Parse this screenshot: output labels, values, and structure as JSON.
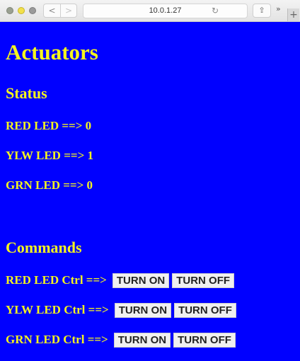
{
  "browser": {
    "url": "10.0.1.27",
    "back_glyph": "<",
    "forward_glyph": ">",
    "reload_glyph": "↻",
    "share_glyph": "⇪",
    "more_glyph": "»",
    "new_tab_glyph": "+"
  },
  "page": {
    "title": "Actuators",
    "status": {
      "heading": "Status",
      "rows": [
        {
          "label": "RED LED ==> 0"
        },
        {
          "label": "YLW LED ==> 1"
        },
        {
          "label": "GRN LED ==> 0"
        }
      ]
    },
    "commands": {
      "heading": "Commands",
      "rows": [
        {
          "label": "RED LED Ctrl ==>",
          "on": "TURN ON",
          "off": "TURN OFF"
        },
        {
          "label": "YLW LED Ctrl ==>",
          "on": "TURN ON",
          "off": "TURN OFF"
        },
        {
          "label": "GRN LED Ctrl ==>",
          "on": "TURN ON",
          "off": "TURN OFF"
        }
      ]
    }
  },
  "colors": {
    "background": "#0000ff",
    "text": "#f5f51e",
    "button": "#f0f0f0"
  }
}
